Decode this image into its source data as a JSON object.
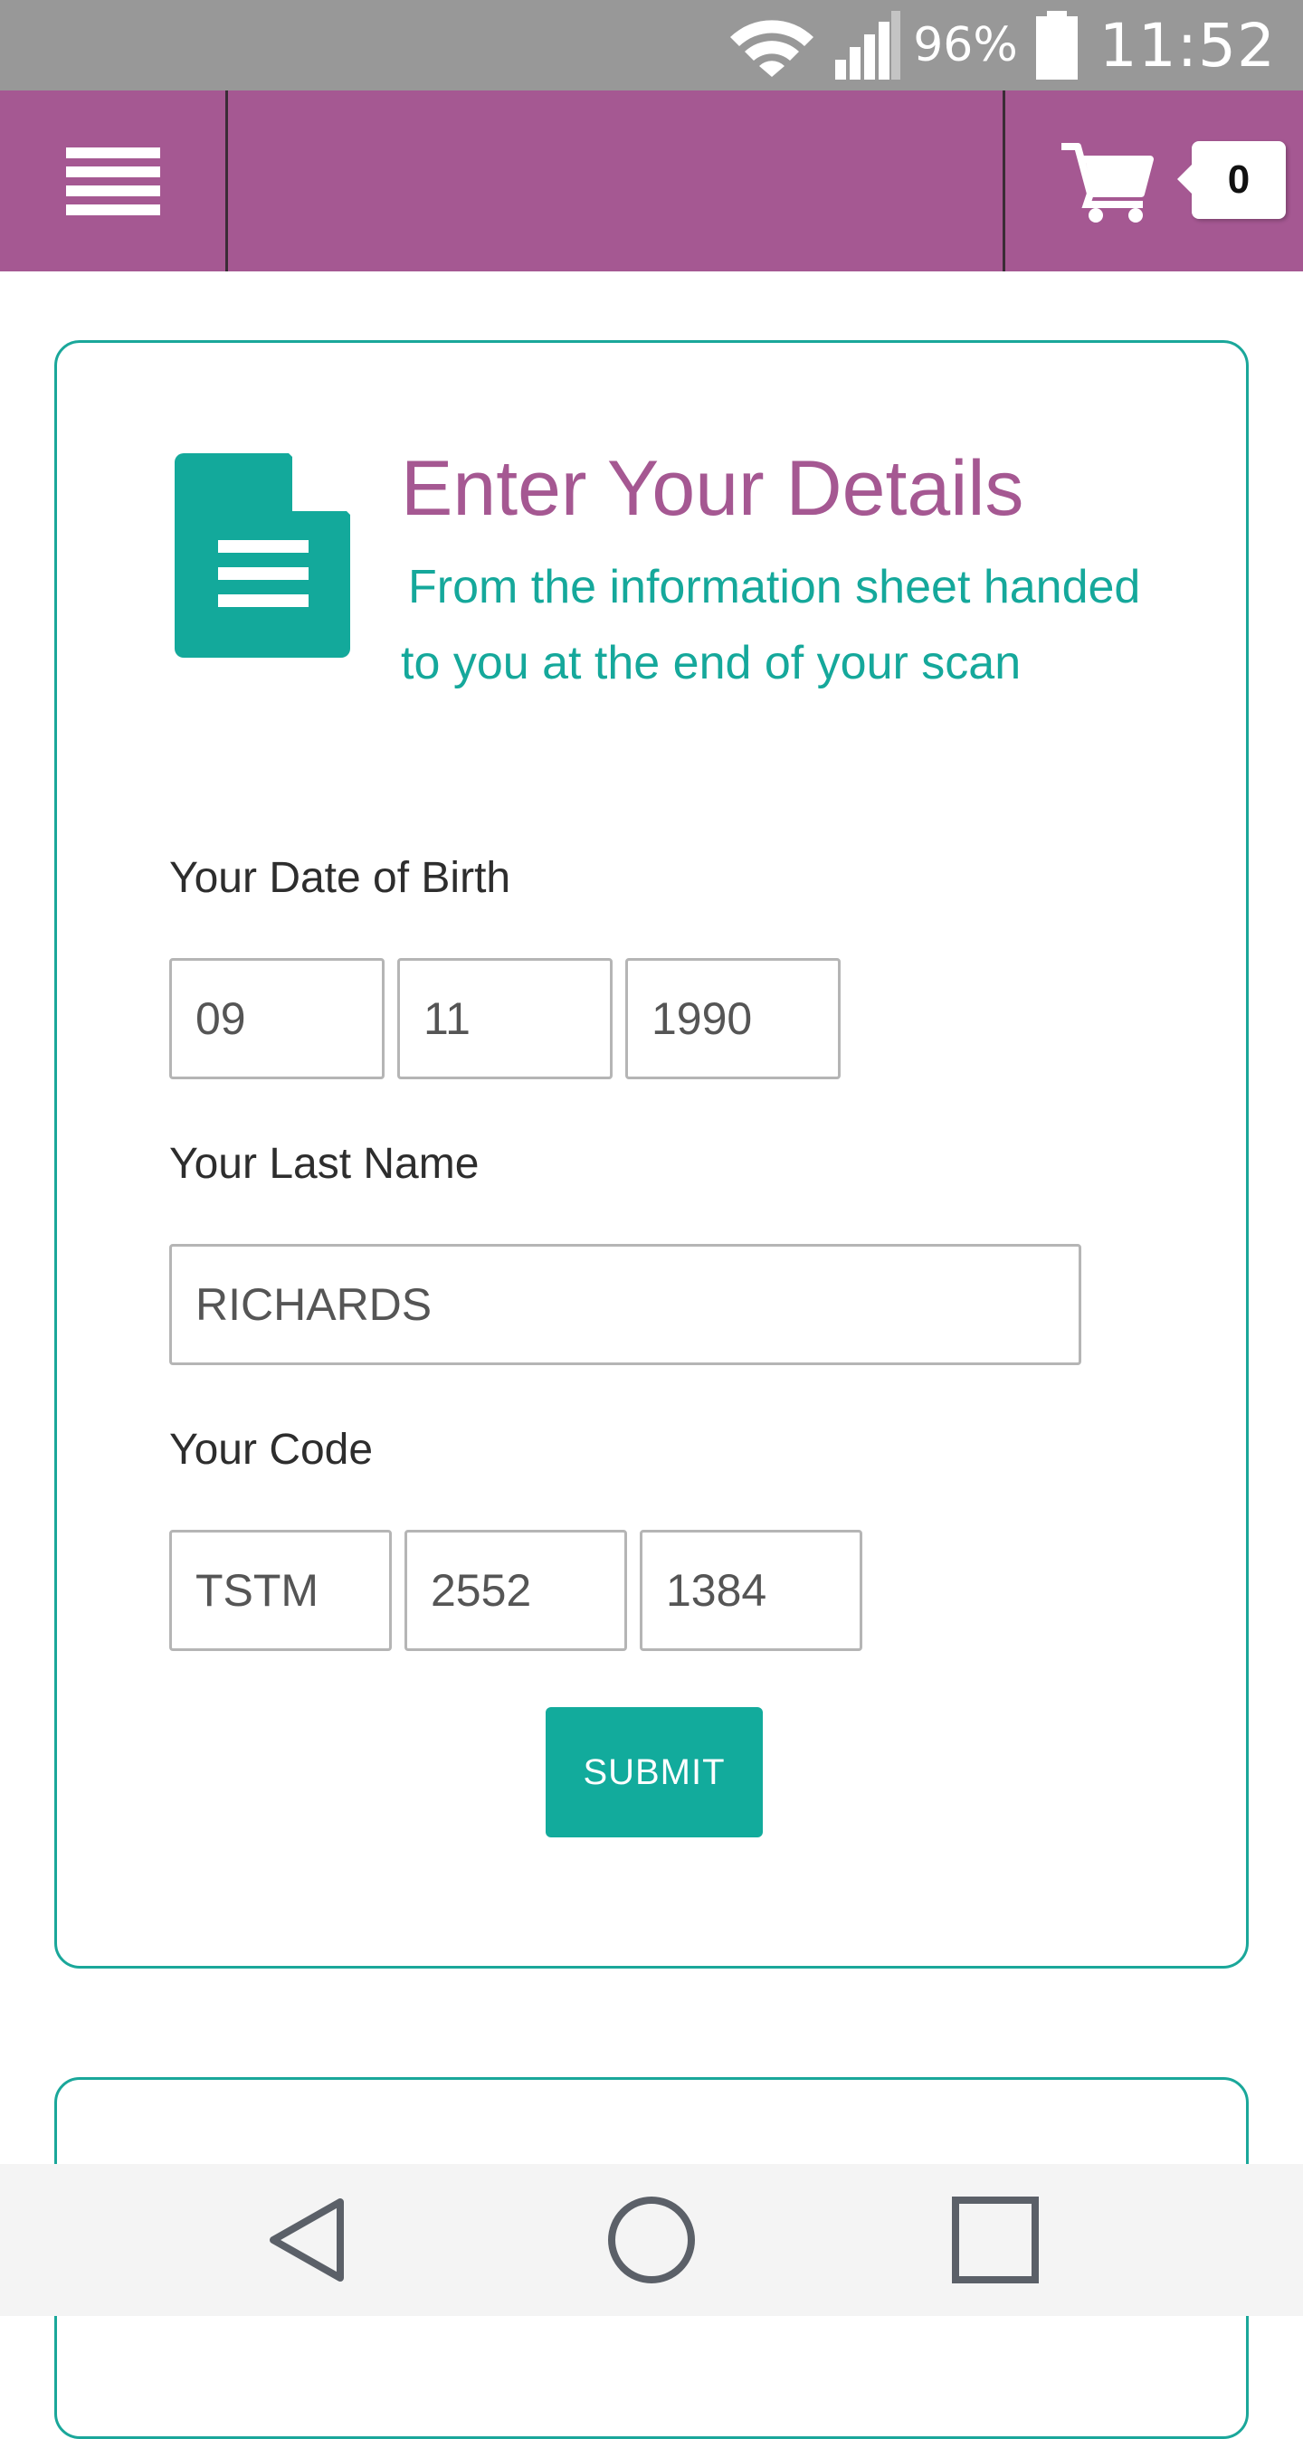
{
  "status_bar": {
    "battery_percent": "96%",
    "time": "11:52",
    "icons": [
      "wifi-icon",
      "signal-icon",
      "battery-icon"
    ]
  },
  "header": {
    "menu_icon": "hamburger-menu-icon",
    "cart_icon": "shopping-cart-icon",
    "cart_count": "0",
    "brand_color": "#a55892"
  },
  "card": {
    "icon": "document-icon",
    "title": "Enter Your Details",
    "subtitle": "From the information sheet handed to you at the end of your scan",
    "accent_color": "#15a89b",
    "dob": {
      "label": "Your Date of Birth",
      "day": "09",
      "month": "11",
      "year": "1990"
    },
    "last_name": {
      "label": "Your Last Name",
      "value": "RICHARDS"
    },
    "code": {
      "label": "Your Code",
      "part1": "TSTM",
      "part2": "2552",
      "part3": "1384"
    },
    "submit_label": "SUBMIT"
  },
  "nav_bar": {
    "icons": [
      "back-icon",
      "home-icon",
      "recents-icon"
    ]
  }
}
